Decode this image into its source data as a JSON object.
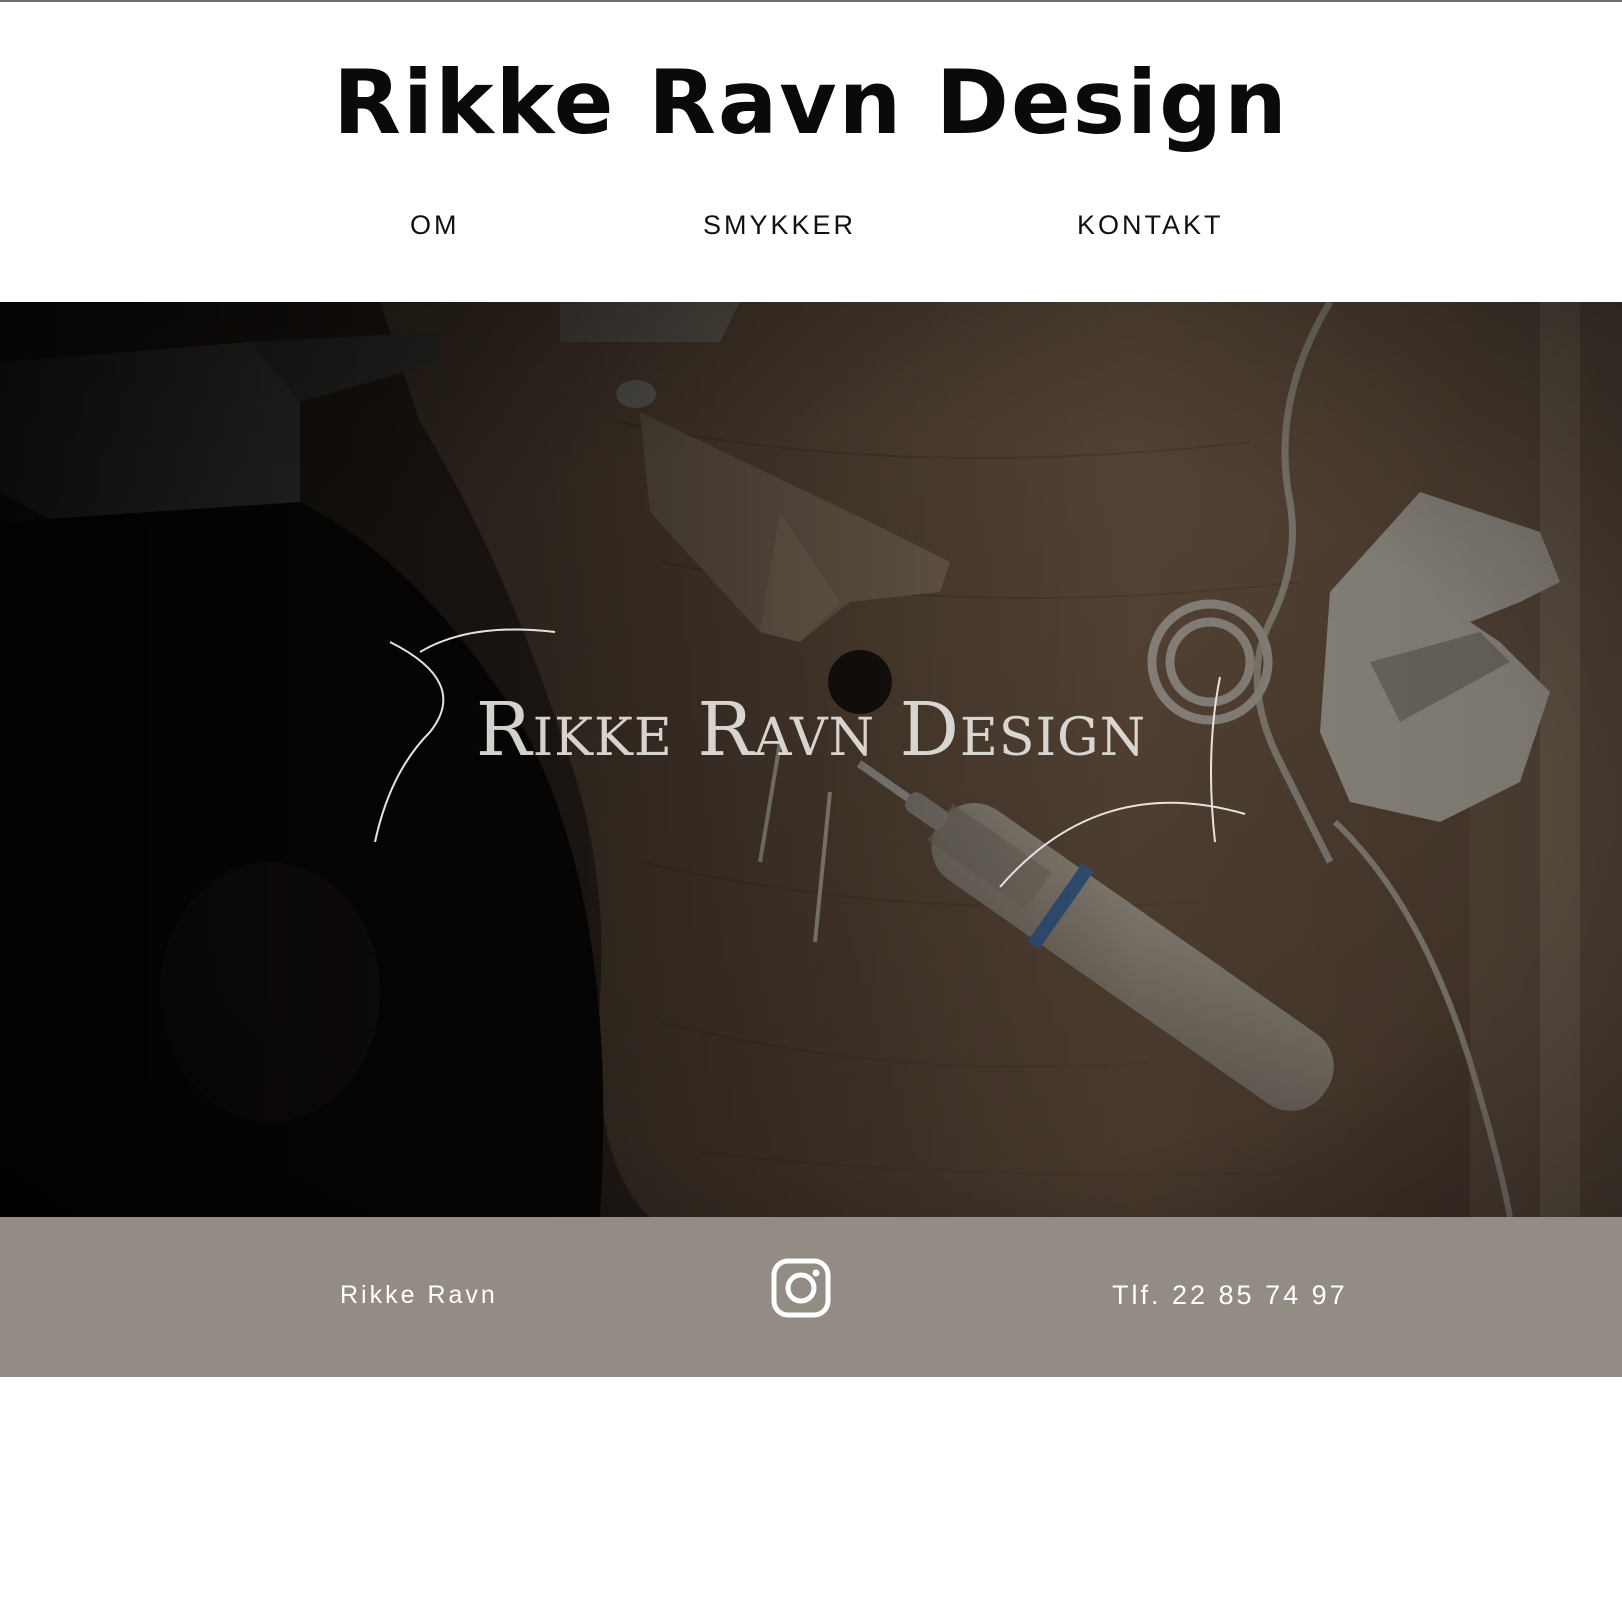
{
  "site": {
    "title": "Rikke Ravn Design"
  },
  "nav": {
    "items": [
      {
        "label": "OM"
      },
      {
        "label": "SMYKKER"
      },
      {
        "label": "KONTAKT"
      }
    ]
  },
  "hero": {
    "logo_text": "Rikke Ravn Design",
    "logo_color": "#e6e3df"
  },
  "footer": {
    "name": "Rikke Ravn",
    "social_icon": "instagram-icon",
    "phone": "Tlf. 22 85 74 97",
    "background": "#938c85"
  }
}
